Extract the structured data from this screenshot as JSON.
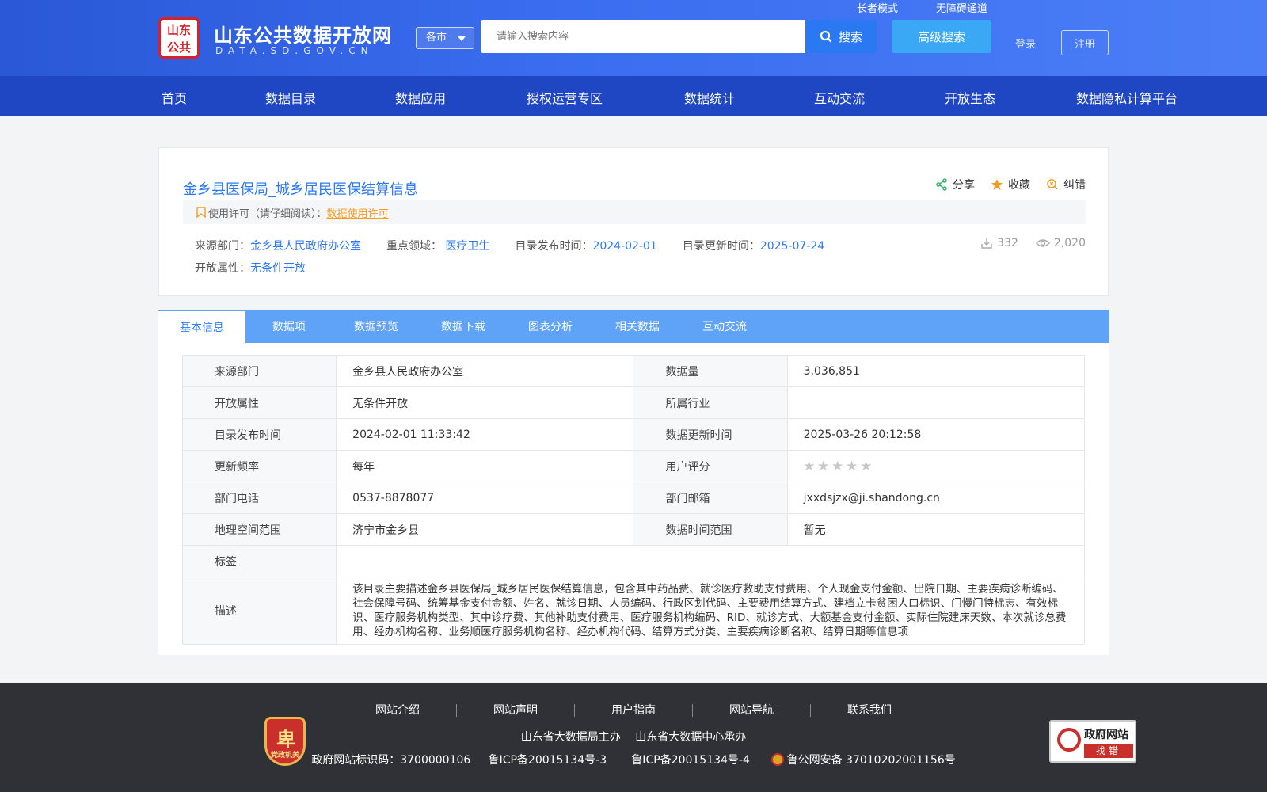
{
  "header": {
    "logo_seal": "山东\n公共",
    "site_title": "山东公共数据开放网",
    "site_domain": "DATA.SD.GOV.CN",
    "city_select": "各市",
    "search_placeholder": "请输入搜索内容",
    "search_label": "搜索",
    "advanced_search_label": "高级搜索",
    "elder_mode": "长者模式",
    "accessibility": "无障碍通道",
    "login": "登录",
    "register": "注册"
  },
  "nav": {
    "items": [
      "首页",
      "数据目录",
      "数据应用",
      "授权运营专区",
      "数据统计",
      "互动交流",
      "开放生态",
      "数据隐私计算平台"
    ]
  },
  "detail": {
    "title": "金乡县医保局_城乡居民医保结算信息",
    "actions": {
      "share": "分享",
      "favorite": "收藏",
      "report": "纠错"
    },
    "license_prefix": "使用许可（请仔细阅读）：",
    "license_link": "数据使用许可",
    "source_label": "来源部门：",
    "source_value": "金乡县人民政府办公室",
    "domain_label": "重点领域：",
    "domain_value": "医疗卫生",
    "publish_label": "目录发布时间：",
    "publish_value": "2024-02-01",
    "update_label": "目录更新时间：",
    "update_value": "2025-07-24",
    "open_label": "开放属性：",
    "open_value": "无条件开放",
    "downloads": "332",
    "views": "2,020"
  },
  "tabs": [
    "基本信息",
    "数据项",
    "数据预览",
    "数据下载",
    "图表分析",
    "相关数据",
    "互动交流"
  ],
  "info_table": {
    "rows": [
      {
        "k1": "来源部门",
        "v1": "金乡县人民政府办公室",
        "k2": "数据量",
        "v2": "3,036,851"
      },
      {
        "k1": "开放属性",
        "v1": "无条件开放",
        "k2": "所属行业",
        "v2": ""
      },
      {
        "k1": "目录发布时间",
        "v1": "2024-02-01 11:33:42",
        "k2": "数据更新时间",
        "v2": "2025-03-26 20:12:58"
      },
      {
        "k1": "更新频率",
        "v1": "每年",
        "k2": "用户评分",
        "v2": ""
      },
      {
        "k1": "部门电话",
        "v1": "0537-8878077",
        "k2": "部门邮箱",
        "v2": "jxxdsjzx@ji.shandong.cn"
      },
      {
        "k1": "地理空间范围",
        "v1": "济宁市金乡县",
        "k2": "数据时间范围",
        "v2": "暂无"
      }
    ],
    "rating": 0,
    "tags_label": "标签",
    "tags_value": "",
    "desc_label": "描述",
    "desc_value": "该目录主要描述金乡县医保局_城乡居民医保结算信息，包含其中药品费、就诊医疗救助支付费用、个人现金支付金额、出院日期、主要疾病诊断编码、社会保障号码、统筹基金支付金额、姓名、就诊日期、人员编码、行政区划代码、主要费用结算方式、建档立卡贫困人口标识、门慢门特标志、有效标识、医疗服务机构类型、其中诊疗费、其他补助支付费用、医疗服务机构编码、RID、就诊方式、大额基金支付金额、实际住院建床天数、本次就诊总费用、经办机构名称、业务顺医疗服务机构名称、经办机构代码、结算方式分类、主要疾病诊断名称、结算日期等信息项"
  },
  "footer": {
    "links": [
      "网站介绍",
      "网站声明",
      "用户指南",
      "网站导航",
      "联系我们"
    ],
    "host_line": "山东省大数据局主办　 山东省大数据中心承办",
    "gov_id": "政府网站标识码：3700000106",
    "icp1": "鲁ICP备20015134号-3",
    "icp2": "鲁ICP备20015134号-4",
    "police": "鲁公网安备 37010202001156号",
    "party_badge": "党政机关",
    "gov_find_title": "政府网站",
    "gov_find_sub": "找错"
  }
}
